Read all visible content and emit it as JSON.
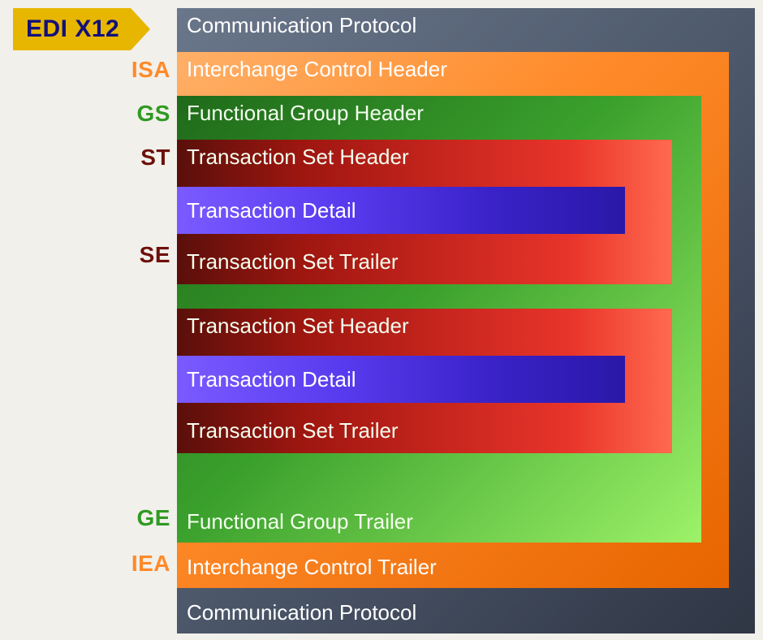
{
  "title": "EDI X12",
  "codes": {
    "isa": "ISA",
    "gs": "GS",
    "st": "ST",
    "se": "SE",
    "ge": "GE",
    "iea": "IEA"
  },
  "colors": {
    "isa": "#ff8a29",
    "gs": "#2f9a22",
    "st": "#6e0f0a",
    "iea": "#ff8a29",
    "ge": "#2f9a22",
    "se": "#6e0f0a"
  },
  "envelopes": {
    "comm": {
      "header": "Communication Protocol",
      "footer": "Communication Protocol"
    },
    "isa": {
      "header": "Interchange Control Header",
      "footer": "Interchange Control Trailer"
    },
    "gs": {
      "header": "Functional Group Header",
      "footer": "Functional Group Trailer"
    },
    "st": [
      {
        "header": "Transaction Set Header",
        "detail": "Transaction Detail",
        "footer": "Transaction Set Trailer"
      },
      {
        "header": "Transaction Set Header",
        "detail": "Transaction Detail",
        "footer": "Transaction Set Trailer"
      }
    ]
  }
}
